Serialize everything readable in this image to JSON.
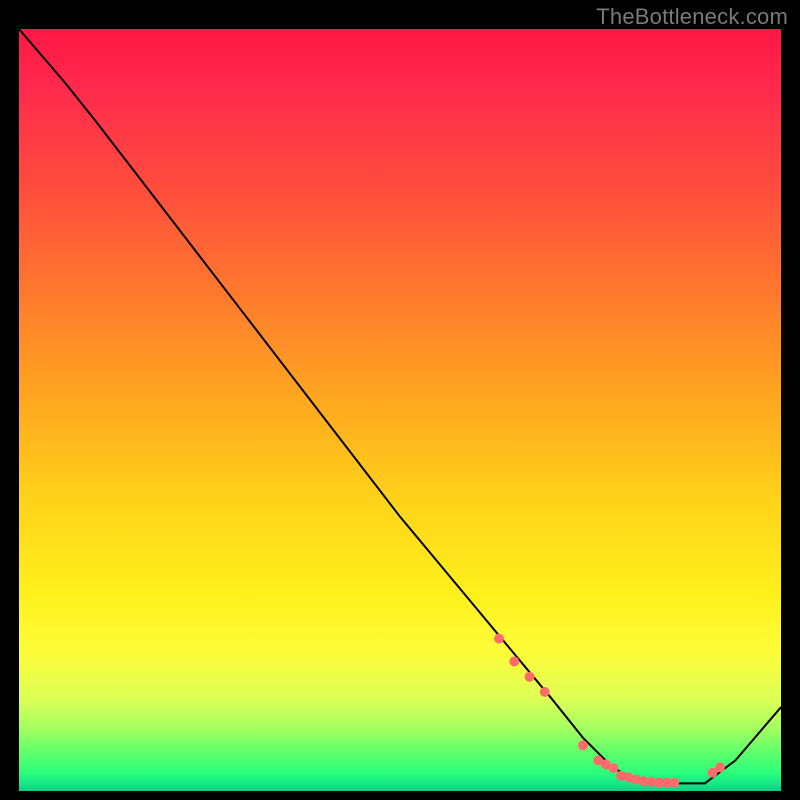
{
  "watermark": "TheBottleneck.com",
  "chart_data": {
    "type": "line",
    "title": "",
    "xlabel": "",
    "ylabel": "",
    "xlim": [
      0,
      100
    ],
    "ylim": [
      0,
      100
    ],
    "series": [
      {
        "name": "curve",
        "color": "#000000",
        "x": [
          0,
          6,
          10,
          20,
          30,
          40,
          50,
          60,
          65,
          70,
          74,
          78,
          82,
          86,
          90,
          94,
          100
        ],
        "y": [
          100,
          93,
          88,
          75,
          62,
          49,
          36,
          24,
          18,
          12,
          7,
          3,
          1,
          1,
          1,
          4,
          11
        ]
      }
    ],
    "markers": [
      {
        "name": "dots",
        "color": "#ff6b6b",
        "size": 10,
        "x": [
          63,
          65,
          67,
          69,
          74,
          76,
          77,
          78,
          79,
          80,
          81,
          82,
          83,
          84,
          85,
          86,
          91,
          92
        ],
        "y": [
          20,
          17,
          15,
          13,
          6,
          4,
          3.5,
          3,
          2,
          1.8,
          1.5,
          1.3,
          1.2,
          1.1,
          1.1,
          1.1,
          2.4,
          3.1
        ]
      }
    ],
    "colors": {
      "gradient_top": "#ff1744",
      "gradient_mid": "#ffe01c",
      "gradient_bottom": "#14e787",
      "marker": "#ff6b6b",
      "line": "#000000",
      "background": "#000000",
      "watermark": "#7a7a7a"
    }
  }
}
